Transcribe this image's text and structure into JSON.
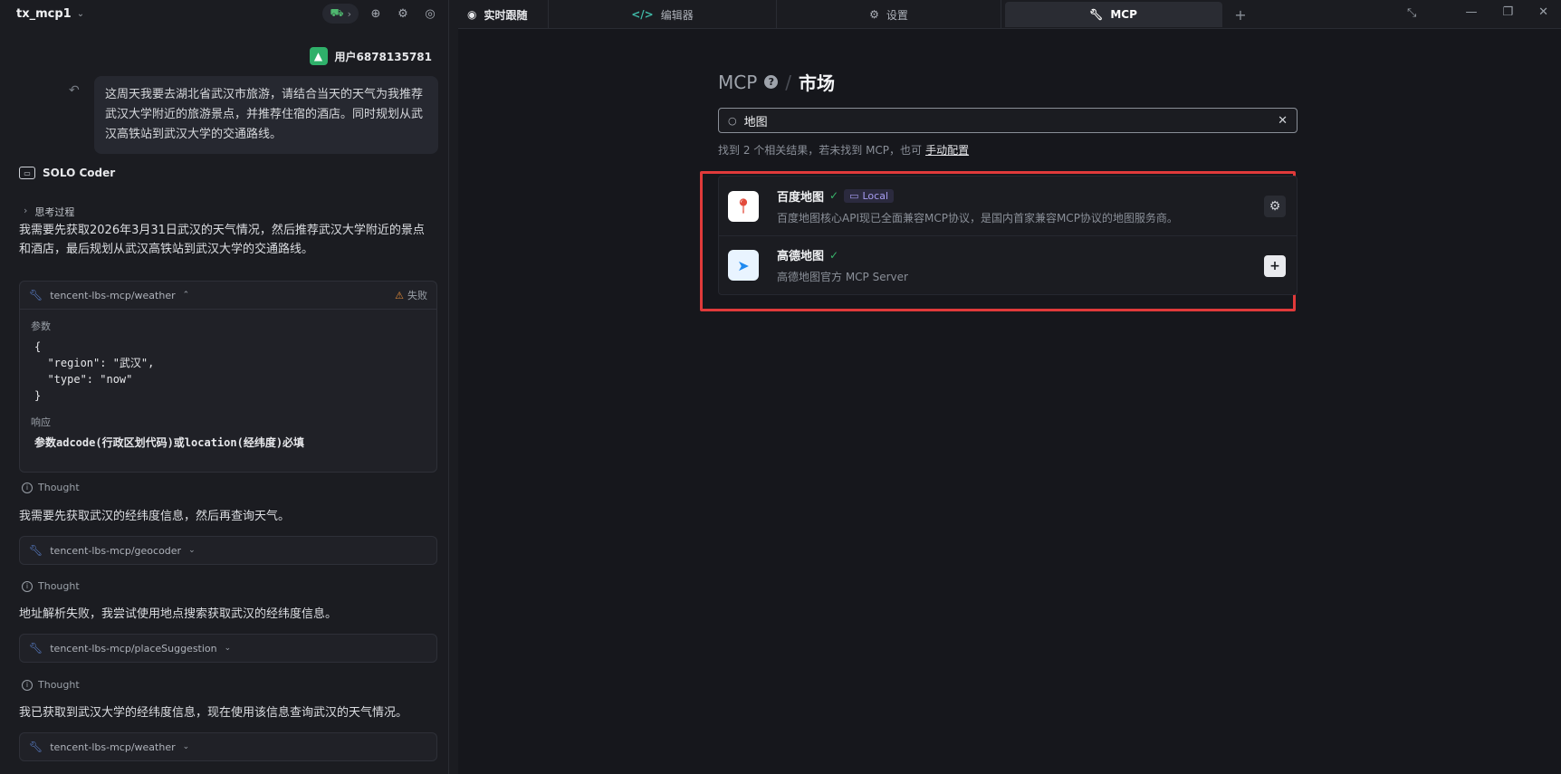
{
  "left": {
    "project": "tx_mcp1",
    "user": {
      "name": "用户6878135781"
    },
    "user_message": "这周天我要去湖北省武汉市旅游，请结合当天的天气为我推荐武汉大学附近的旅游景点，并推荐住宿的酒店。同时规划从武汉高铁站到武汉大学的交通路线。",
    "agent_name": "SOLO Coder",
    "thinking_label": "思考过程",
    "para1": "我需要先获取2026年3月31日武汉的天气情况，然后推荐武汉大学附近的景点和酒店，最后规划从武汉高铁站到武汉大学的交通路线。",
    "tool1": {
      "name": "tencent-lbs-mcp/weather",
      "status": "失败",
      "params_label": "参数",
      "params_code": "{\n  \"region\": \"武汉\",\n  \"type\": \"now\"\n}",
      "response_label": "响应",
      "response": "参数adcode(行政区划代码)或location(经纬度)必填"
    },
    "thought_label": "Thought",
    "para2": "我需要先获取武汉的经纬度信息，然后再查询天气。",
    "tool2": {
      "name": "tencent-lbs-mcp/geocoder"
    },
    "para3": "地址解析失败，我尝试使用地点搜索获取武汉的经纬度信息。",
    "tool3": {
      "name": "tencent-lbs-mcp/placeSuggestion"
    },
    "para4": "我已获取到武汉大学的经纬度信息，现在使用该信息查询武汉的天气情况。",
    "tool4": {
      "name": "tencent-lbs-mcp/weather"
    }
  },
  "tabs": {
    "t1": "实时跟随",
    "t2": "编辑器",
    "t3": "设置",
    "t4": "MCP"
  },
  "main": {
    "crumb_mcp": "MCP",
    "crumb_market": "市场",
    "search_value": "地图",
    "found_text": "找到 2 个相关结果，若未找到 MCP，也可",
    "manual_link": "手动配置",
    "results": [
      {
        "name": "百度地图",
        "tag": "Local",
        "desc": "百度地图核心API现已全面兼容MCP协议，是国内首家兼容MCP协议的地图服务商。"
      },
      {
        "name": "高德地图",
        "desc": "高德地图官方 MCP Server"
      }
    ]
  },
  "colors": {
    "accent_green": "#38b26a",
    "highlight_red": "#e03a3a",
    "bg": "#16171c"
  }
}
